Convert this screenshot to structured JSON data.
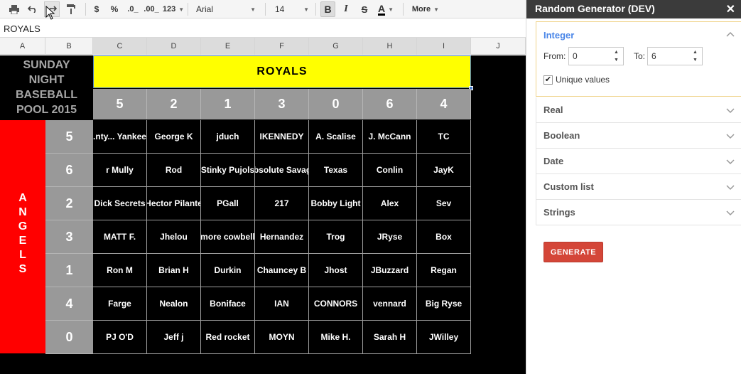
{
  "toolbar": {
    "currency": "$",
    "percent": "%",
    "dec_decrease": ".0_",
    "dec_increase": ".00_",
    "number_format": "123",
    "font": "Arial",
    "font_size": "14",
    "bold": "B",
    "italic": "I",
    "strike": "S",
    "text_color": "A",
    "more": "More"
  },
  "formula_bar": {
    "value": "ROYALS"
  },
  "columns": [
    "A",
    "B",
    "C",
    "D",
    "E",
    "F",
    "G",
    "H",
    "I",
    "J"
  ],
  "sheet": {
    "title_lines": [
      "SUNDAY",
      "NIGHT",
      "BASEBALL",
      "POOL 2015"
    ],
    "royals_label": "ROYALS",
    "angels_letters": [
      "A",
      "N",
      "G",
      "E",
      "L",
      "S"
    ],
    "royals_numbers": [
      "5",
      "2",
      "1",
      "3",
      "0",
      "6",
      "4"
    ],
    "angels_numbers": [
      "5",
      "6",
      "2",
      "3",
      "1",
      "4",
      "0"
    ],
    "names": [
      [
        "...nty... Yankees",
        "George K",
        "jduch",
        "IKENNEDY",
        "A. Scalise",
        "J. McCann",
        "TC"
      ],
      [
        "r Mully",
        "Rod",
        "Stinky Pujols",
        "Absolute Savage",
        "Texas",
        "Conlin",
        "JayK"
      ],
      [
        "Dick Secrets",
        "Hector Pilante",
        "PGall",
        "217",
        "Bobby Light",
        "Alex",
        "Sev"
      ],
      [
        "MATT F.",
        "Jhelou",
        "more cowbell",
        "Hernandez",
        "Trog",
        "JRyse",
        "Box"
      ],
      [
        "Ron M",
        "Brian H",
        "Durkin",
        "Chauncey B",
        "Jhost",
        "JBuzzard",
        "Regan"
      ],
      [
        "Farge",
        "Nealon",
        "Boniface",
        "IAN",
        "CONNORS",
        "vennard",
        "Big Ryse"
      ],
      [
        "PJ O'D",
        "Jeff j",
        "Red rocket",
        "MOYN",
        "Mike H.",
        "Sarah H",
        "JWilley"
      ]
    ],
    "colors": {
      "background": "#000000",
      "royals_band": "#ffff00",
      "angels_band": "#ff0000",
      "number_cells": "#999999"
    }
  },
  "panel": {
    "title": "Random Generator (DEV)",
    "close": "✕",
    "integer": {
      "label": "Integer",
      "from_label": "From:",
      "from_value": "0",
      "to_label": "To:",
      "to_value": "6",
      "unique_label": "Unique values",
      "unique_checked": "✔"
    },
    "sections": [
      "Real",
      "Boolean",
      "Date",
      "Custom list",
      "Strings"
    ],
    "generate_label": "GENERATE",
    "accent": "#4a86e8",
    "generate_color": "#d44638"
  }
}
